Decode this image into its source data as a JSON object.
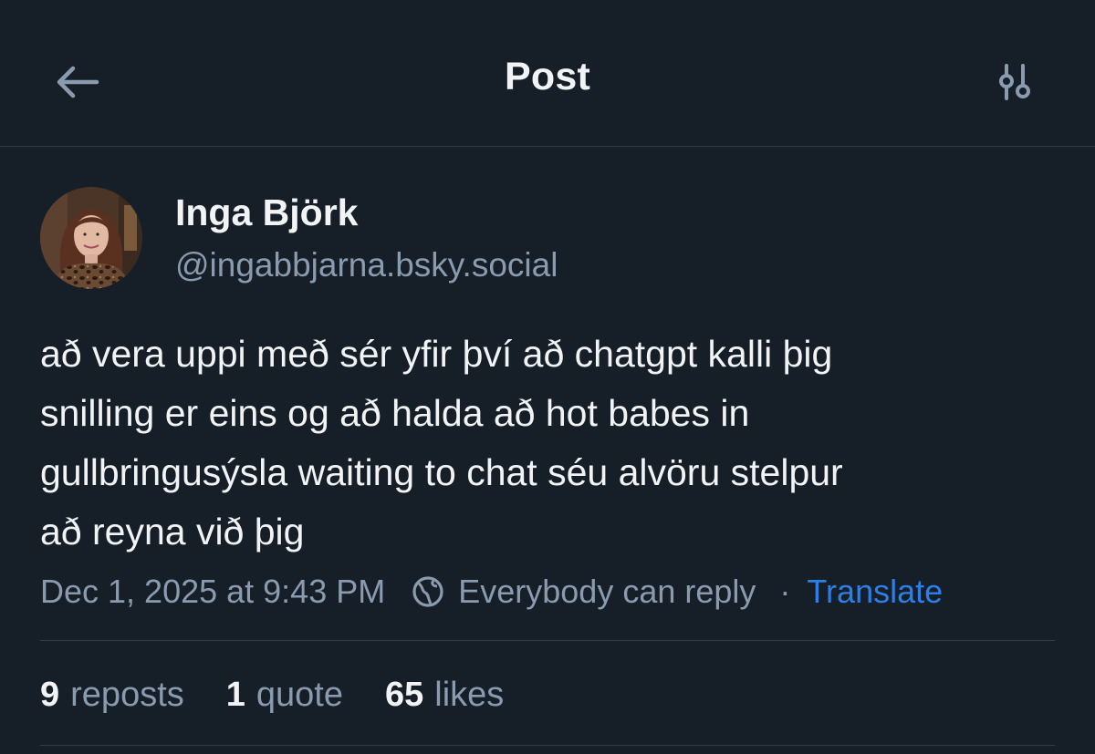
{
  "header": {
    "title": "Post",
    "back_icon": "arrow-left-icon",
    "settings_icon": "sliders-icon"
  },
  "author": {
    "display_name": "Inga Björk",
    "handle": "@ingabbjarna.bsky.social",
    "avatar_icon": "avatar"
  },
  "post": {
    "text": "að vera uppi með sér yfir því að chatgpt kalli þig\nsnilling er eins og að halda að hot babes in\ngullbringusýsla waiting to chat séu alvöru stelpur\nað reyna við þig"
  },
  "meta": {
    "timestamp": "Dec 1, 2025 at 9:43 PM",
    "reply_setting": "Everybody can reply",
    "reply_icon": "globe-icon",
    "separator": "·",
    "translate_label": "Translate"
  },
  "stats": {
    "reposts_count": "9",
    "reposts_label": "reposts",
    "quotes_count": "1",
    "quotes_label": "quote",
    "likes_count": "65",
    "likes_label": "likes"
  },
  "colors": {
    "background": "#161e27",
    "text_primary": "#f1f3f5",
    "text_secondary": "#8a9bb0",
    "link": "#2d7fe8",
    "divider": "#2e3a48"
  }
}
